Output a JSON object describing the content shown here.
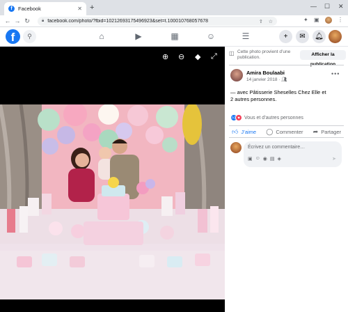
{
  "browser": {
    "tab_title": "Facebook",
    "tab_favicon": "f",
    "tab_close": "✕",
    "new_tab": "+",
    "url": "facebook.com/photo/?fbid=10212693175496923&set=t.100010768057678"
  },
  "header": {
    "logo": "f"
  },
  "notice": {
    "text": "Cette photo provient d’une publication.",
    "button": "Afficher la publication"
  },
  "post": {
    "author": "Amira Boulaabi",
    "date": "14 janvier 2018 · ",
    "caption_prefix": "— avec ",
    "caption_page": "Pâtisserie Sheselles Chez Elle",
    "caption_suffix": " et",
    "caption_line2": "2 autres personnes.",
    "reactions_text": "Vous et d’autres personnes"
  },
  "actions": {
    "like": "J’aime",
    "comment": "Commenter",
    "share": "Partager"
  },
  "comment": {
    "placeholder": "Écrivez un commentaire…"
  },
  "colors": {
    "fb_blue": "#1877f2",
    "love_red": "#f33e58"
  }
}
